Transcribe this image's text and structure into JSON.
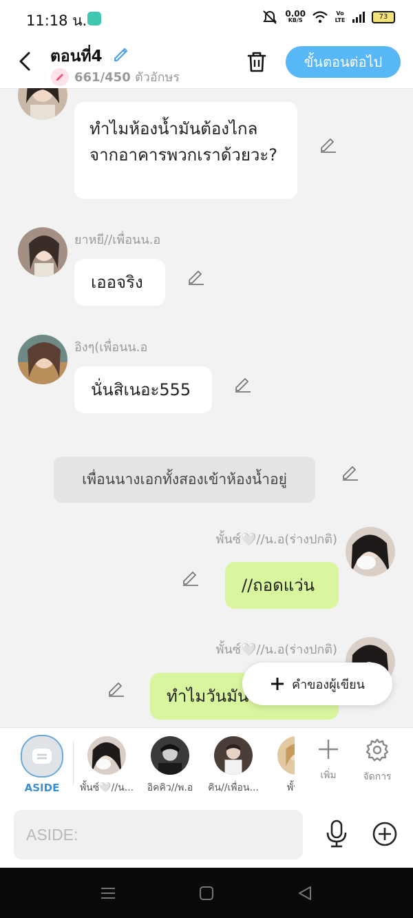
{
  "status": {
    "time": "11:18 น.",
    "net_speed": "0.00",
    "net_unit": "KB/S",
    "volte": "Vo LTE",
    "battery": "73"
  },
  "header": {
    "title": "ตอนที่4",
    "count_value": "661/450",
    "count_unit": "ตัวอักษร",
    "next_label": "ขั้นตอนต่อไป"
  },
  "messages": [
    {
      "text": "ทำไมห้องน้ำมันต้องไกลจากอาคารพวกเราด้วยวะ?"
    },
    {
      "sender": "ยาหยี//เพื่อนน.อ",
      "text": "เออจริง"
    },
    {
      "sender": "อิงๆ(เพื่อนน.อ",
      "text": "นั่นสิเนอะ555"
    },
    {
      "narration": "เพื่อนนางเอกทั้งสองเข้าห้องน้ำอยู่"
    },
    {
      "sender": "พั้นซ์🤍//น.อ(ร่างปกติ)",
      "text": "//ถอดแว่น"
    },
    {
      "sender": "พั้นซ์🤍//น.อ(ร่างปกติ)",
      "text": "ทำไมวันมัน"
    }
  ],
  "writer_button": "คำของผู้เขียน",
  "characters": {
    "aside_label": "ASIDE",
    "items": [
      {
        "name": "พั้นซ์🤍//น..."
      },
      {
        "name": "อิคคิว//พ.อ"
      },
      {
        "name": "คิน//เพื่อน..."
      },
      {
        "name": "พั้นซ์"
      }
    ],
    "add_label": "เพิ่ม",
    "manage_label": "จัดการ"
  },
  "input": {
    "placeholder": "ASIDE:"
  }
}
